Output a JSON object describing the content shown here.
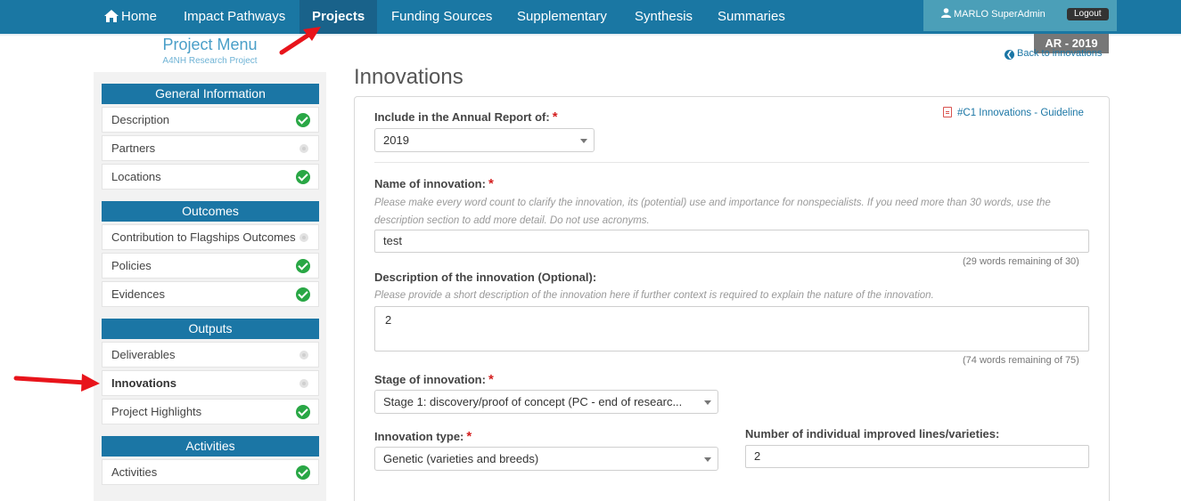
{
  "nav": {
    "items": [
      {
        "label": "Home",
        "icon": "home-icon"
      },
      {
        "label": "Impact Pathways"
      },
      {
        "label": "Projects",
        "active": true
      },
      {
        "label": "Funding Sources"
      },
      {
        "label": "Supplementary"
      },
      {
        "label": "Synthesis"
      },
      {
        "label": "Summaries"
      }
    ],
    "user": "MARLO SuperAdmin",
    "logout": "Logout",
    "badge": "AR - 2019",
    "back_link": "Back to innovations"
  },
  "sidebar": {
    "title": "Project Menu",
    "subtitle": "A4NH Research Project",
    "sections": [
      {
        "header": "General Information",
        "items": [
          {
            "label": "Description",
            "status": "complete"
          },
          {
            "label": "Partners",
            "status": "pending"
          },
          {
            "label": "Locations",
            "status": "complete"
          }
        ]
      },
      {
        "header": "Outcomes",
        "items": [
          {
            "label": "Contribution to Flagships Outcomes",
            "status": "pending"
          },
          {
            "label": "Policies",
            "status": "complete"
          },
          {
            "label": "Evidences",
            "status": "complete"
          }
        ]
      },
      {
        "header": "Outputs",
        "items": [
          {
            "label": "Deliverables",
            "status": "pending"
          },
          {
            "label": "Innovations",
            "status": "pending",
            "active": true
          },
          {
            "label": "Project Highlights",
            "status": "complete"
          }
        ]
      },
      {
        "header": "Activities",
        "items": [
          {
            "label": "Activities",
            "status": "complete"
          }
        ]
      }
    ]
  },
  "main": {
    "title": "Innovations",
    "guideline_link": "#C1 Innovations - Guideline",
    "annual_report": {
      "label": "Include in the Annual Report of:",
      "value": "2019"
    },
    "name": {
      "label": "Name of innovation:",
      "help": "Please make every word count to clarify the innovation, its (potential) use and importance for nonspecialists. If you need more than 30 words, use the description section to add more detail. Do not use acronyms.",
      "value": "test",
      "counter": "(29 words remaining of 30)"
    },
    "description": {
      "label": "Description of the innovation (Optional):",
      "help": "Please provide a short description of the innovation here if further context is required to explain the nature of the innovation.",
      "value": "2",
      "counter": "(74 words remaining of 75)"
    },
    "stage": {
      "label": "Stage of innovation:",
      "value": "Stage 1: discovery/proof of concept (PC - end of researc..."
    },
    "type": {
      "label": "Innovation type:",
      "value": "Genetic (varieties and breeds)"
    },
    "lines": {
      "label": "Number of individual improved lines/varieties:",
      "value": "2"
    }
  },
  "colors": {
    "nav_bg": "#1a77a3",
    "nav_active": "#19628a",
    "section_header": "#1b76a5",
    "complete_green": "#29a745",
    "required_red": "#d41f1f",
    "annotation_arrow": "#e8141b"
  }
}
